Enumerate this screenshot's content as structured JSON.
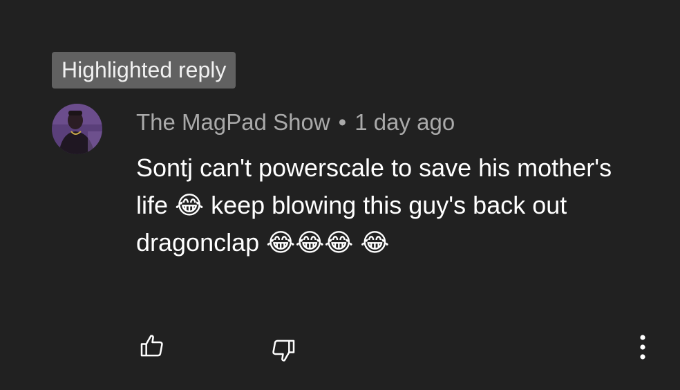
{
  "highlight_badge": "Highlighted reply",
  "comment": {
    "author": "The MagPad Show",
    "separator": "•",
    "timestamp": "1 day ago",
    "text": "Sontj can't powerscale to save his mother's life 😂 keep blowing this guy's back out dragonclap 😂😂😂 😂"
  },
  "actions": {
    "like_icon": "thumbs-up-icon",
    "dislike_icon": "thumbs-down-icon",
    "more_icon": "vertical-ellipsis-icon"
  },
  "colors": {
    "background": "#212121",
    "badge_background": "#616161",
    "meta_text": "#aaaaaa",
    "body_text": "#ffffff"
  }
}
